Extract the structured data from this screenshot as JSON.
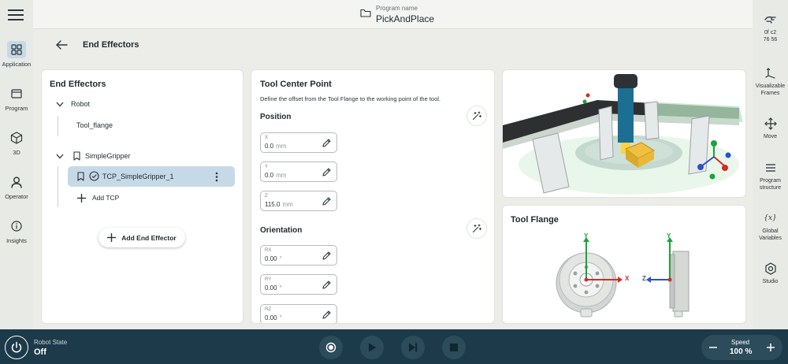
{
  "header": {
    "program_label": "Program name",
    "program_name": "PickAndPlace"
  },
  "left_nav": [
    {
      "label": "Application",
      "icon": "grid-icon",
      "active": true
    },
    {
      "label": "Program",
      "icon": "window-icon"
    },
    {
      "label": "3D",
      "icon": "cube-icon"
    },
    {
      "label": "Operator",
      "icon": "person-icon"
    },
    {
      "label": "Insights",
      "icon": "info-icon"
    }
  ],
  "right_nav": [
    {
      "label": "0f  c2\n76  56",
      "icon": "hand-icon"
    },
    {
      "label": "Visualizable\nFrames",
      "icon": "axes-icon"
    },
    {
      "label": "Move",
      "icon": "move-icon"
    },
    {
      "label": "Program\nstructure",
      "icon": "list-icon"
    },
    {
      "label": "Global\nVariables",
      "icon": "variable-icon"
    },
    {
      "label": "Studio",
      "icon": "hexagon-icon"
    }
  ],
  "page": {
    "title": "End Effectors"
  },
  "tree": {
    "title": "End Effectors",
    "robot": "Robot",
    "tool_flange": "Tool_flange",
    "gripper": "SimpleGripper",
    "tcp": "TCP_SimpleGripper_1",
    "add_tcp": "Add TCP",
    "add_end_effector": "Add End Effector"
  },
  "tcp_panel": {
    "title": "Tool Center Point",
    "description": "Define the offset from the Tool Flange to the working point of the tool.",
    "position_title": "Position",
    "orientation_title": "Orientation",
    "position": [
      {
        "label": "X",
        "value": "0.0",
        "unit": "mm"
      },
      {
        "label": "Y",
        "value": "0.0",
        "unit": "mm"
      },
      {
        "label": "Z",
        "value": "115.0",
        "unit": "mm"
      }
    ],
    "orientation": [
      {
        "label": "RX",
        "value": "0.00",
        "unit": "°"
      },
      {
        "label": "RY",
        "value": "0.00",
        "unit": "°"
      },
      {
        "label": "RZ",
        "value": "0.00",
        "unit": "°"
      }
    ]
  },
  "tool_flange_panel": {
    "title": "Tool Flange",
    "front_axes": {
      "vertical": "Y",
      "horizontal": "X"
    },
    "side_axes": {
      "vertical": "Y",
      "horizontal": "Z"
    }
  },
  "bottom_bar": {
    "robot_state_label": "Robot State",
    "robot_state_value": "Off",
    "speed_label": "Speed",
    "speed_value": "100 %",
    "speed_percent": 100
  },
  "colors": {
    "accent": "#c6d9e6",
    "bottom_bar": "#1d3a4a",
    "axis_y": "#1aa33a",
    "axis_x": "#d42a2a",
    "axis_z": "#2a52c9"
  }
}
